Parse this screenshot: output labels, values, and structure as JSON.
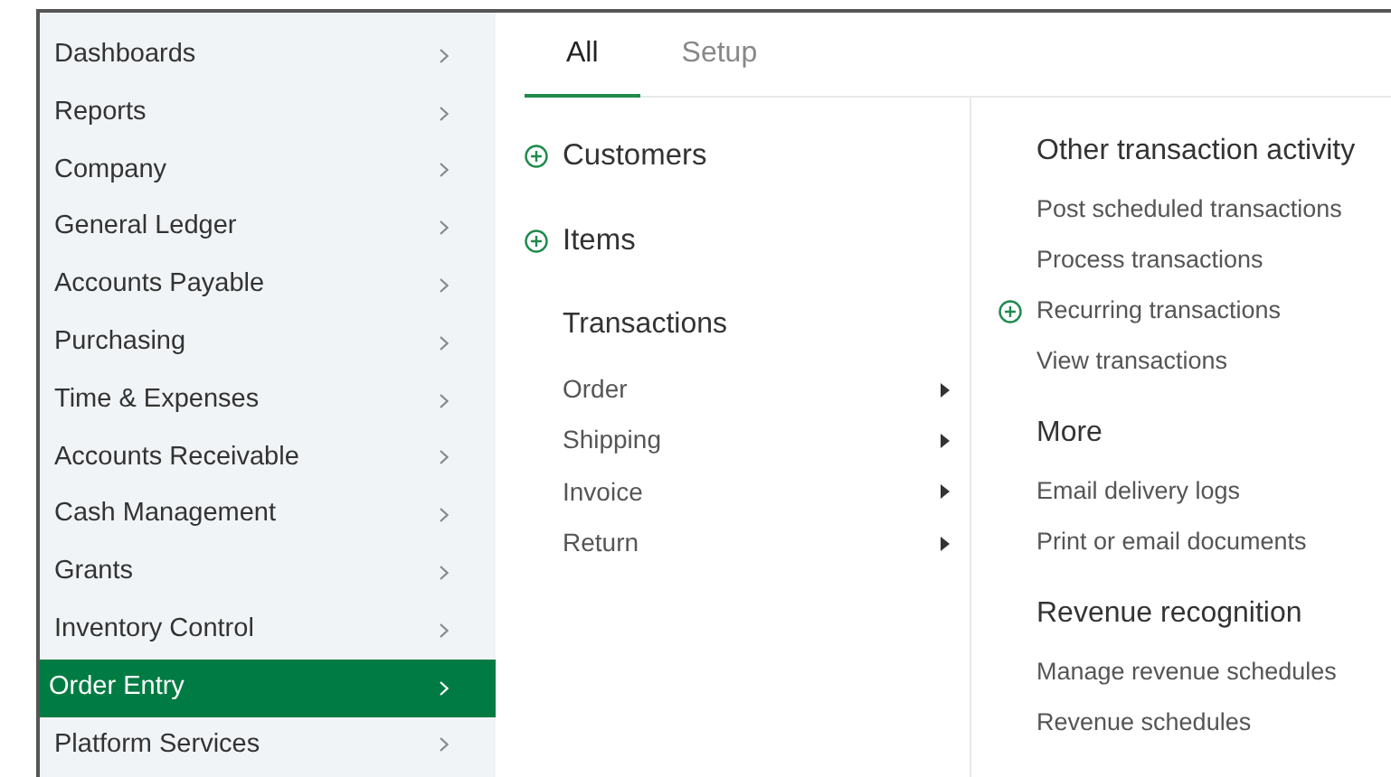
{
  "sidebar": {
    "items": [
      {
        "label": "Dashboards",
        "selected": false
      },
      {
        "label": "Reports",
        "selected": false
      },
      {
        "label": "Company",
        "selected": false
      },
      {
        "label": "General Ledger",
        "selected": false
      },
      {
        "label": "Accounts Payable",
        "selected": false
      },
      {
        "label": "Purchasing",
        "selected": false
      },
      {
        "label": "Time & Expenses",
        "selected": false
      },
      {
        "label": "Accounts Receivable",
        "selected": false
      },
      {
        "label": "Cash Management",
        "selected": false
      },
      {
        "label": "Grants",
        "selected": false
      },
      {
        "label": "Inventory Control",
        "selected": false
      },
      {
        "label": "Order Entry",
        "selected": true
      },
      {
        "label": "Platform Services",
        "selected": false
      }
    ]
  },
  "tabs": [
    {
      "label": "All",
      "selected": true
    },
    {
      "label": "Setup",
      "selected": false
    }
  ],
  "left_column": [
    {
      "kind": "add-link",
      "label": "Customers"
    },
    {
      "kind": "add-link",
      "label": "Items"
    },
    {
      "kind": "heading",
      "label": "Transactions"
    },
    {
      "kind": "submenu",
      "label": "Order"
    },
    {
      "kind": "submenu",
      "label": "Shipping"
    },
    {
      "kind": "submenu",
      "label": "Invoice"
    },
    {
      "kind": "submenu",
      "label": "Return"
    }
  ],
  "right_column": [
    {
      "title": "Other transaction activity",
      "links": [
        {
          "label": "Post scheduled transactions",
          "has_add": false
        },
        {
          "label": "Process transactions",
          "has_add": false
        },
        {
          "label": "Recurring transactions",
          "has_add": true
        },
        {
          "label": "View transactions",
          "has_add": false
        }
      ]
    },
    {
      "title": "More",
      "links": [
        {
          "label": "Email delivery logs",
          "has_add": false
        },
        {
          "label": "Print or email documents",
          "has_add": false
        }
      ]
    },
    {
      "title": "Revenue recognition",
      "links": [
        {
          "label": "Manage revenue schedules",
          "has_add": false
        },
        {
          "label": "Revenue schedules",
          "has_add": false
        }
      ]
    }
  ]
}
